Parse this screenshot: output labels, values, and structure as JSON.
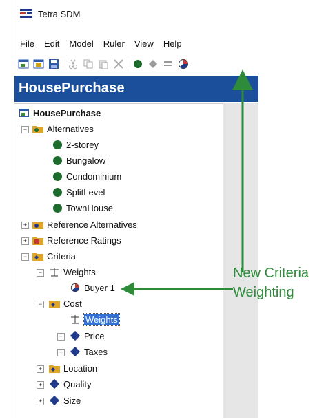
{
  "window": {
    "title": "Tetra SDM"
  },
  "menu": [
    "File",
    "Edit",
    "Model",
    "Ruler",
    "View",
    "Help"
  ],
  "header": {
    "title": "HousePurchase"
  },
  "tree": {
    "root": "HousePurchase",
    "alternatives": {
      "label": "Alternatives",
      "items": [
        "2-storey",
        "Bungalow",
        "Condominium",
        "SplitLevel",
        "TownHouse"
      ]
    },
    "reference_alternatives": "Reference Alternatives",
    "reference_ratings": "Reference Ratings",
    "criteria": {
      "label": "Criteria",
      "weights": "Weights",
      "buyer": "Buyer 1",
      "cost": {
        "label": "Cost",
        "weights": "Weights",
        "price": "Price",
        "taxes": "Taxes"
      },
      "location": "Location",
      "quality": "Quality",
      "size": "Size"
    }
  },
  "annotation": {
    "line1": "New Criteria",
    "line2": "Weighting"
  },
  "colors": {
    "header_bg": "#1b4f9c",
    "alt_dot": "#1e6b2e",
    "criterion_diamond": "#1f3a8a",
    "annotation": "#2e8b3a",
    "selection": "#3370d6"
  }
}
